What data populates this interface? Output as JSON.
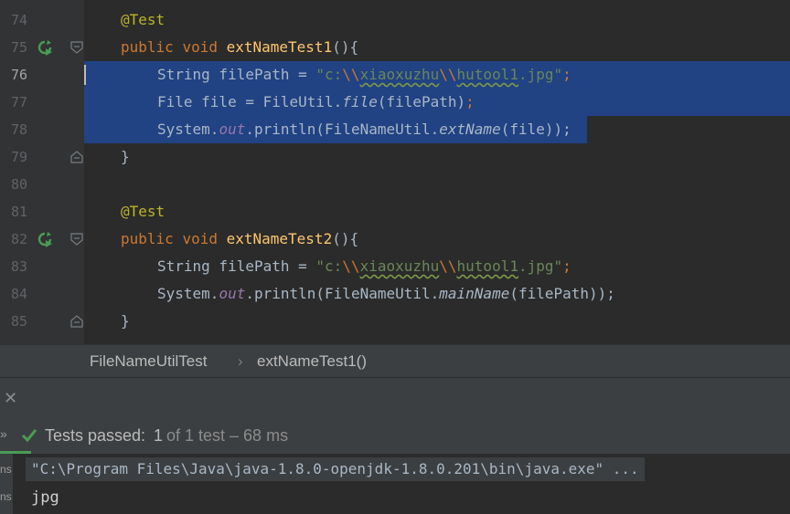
{
  "editor": {
    "lines": [
      {
        "num": "74"
      },
      {
        "num": "75"
      },
      {
        "num": "76"
      },
      {
        "num": "77"
      },
      {
        "num": "78"
      },
      {
        "num": "79"
      },
      {
        "num": "80"
      },
      {
        "num": "81"
      },
      {
        "num": "82"
      },
      {
        "num": "83"
      },
      {
        "num": "84"
      },
      {
        "num": "85"
      }
    ],
    "tok": {
      "at_test": "@Test",
      "public": "public",
      "void": "void",
      "method1": "extNameTest1",
      "method2": "extNameTest2",
      "paren_brace": "(){",
      "string_type": "String filePath = ",
      "str_q_open": "\"c:",
      "str_esc": "\\\\",
      "str_dir": "xiaoxuzhu",
      "str_file": "hutool1",
      "str_ext": ".jpg\"",
      "semicolon": ";",
      "file_decl": "File file = FileUtil.",
      "file_method": "file",
      "file_args": "(filePath)",
      "system": "System.",
      "out": "out",
      "println_open": ".println(FileNameUtil.",
      "extname": "extName",
      "extname_args": "(file));",
      "mainname": "mainName",
      "mainname_args": "(filePath));",
      "close_brace": "}"
    }
  },
  "breadcrumb": {
    "class_name": "FileNameUtilTest",
    "separator": "›",
    "method": "extNameTest1()"
  },
  "run_panel": {
    "close_icon": "close-icon",
    "side_chevron": "»",
    "status_prefix": "Tests passed:",
    "passed_count": "1",
    "status_suffix": "of 1 test – 68 ms",
    "command": "\"C:\\Program Files\\Java\\java-1.8.0-openjdk-1.8.0.201\\bin\\java.exe\" ...",
    "output": "jpg",
    "side_label_1": "ns",
    "side_label_2": "ns"
  },
  "colors": {
    "background": "#2B2B2B",
    "selection": "#214283",
    "keyword": "#CC7832",
    "string": "#6A8759",
    "function": "#FFC66D",
    "annotation": "#BBB529",
    "success": "#499C54"
  }
}
